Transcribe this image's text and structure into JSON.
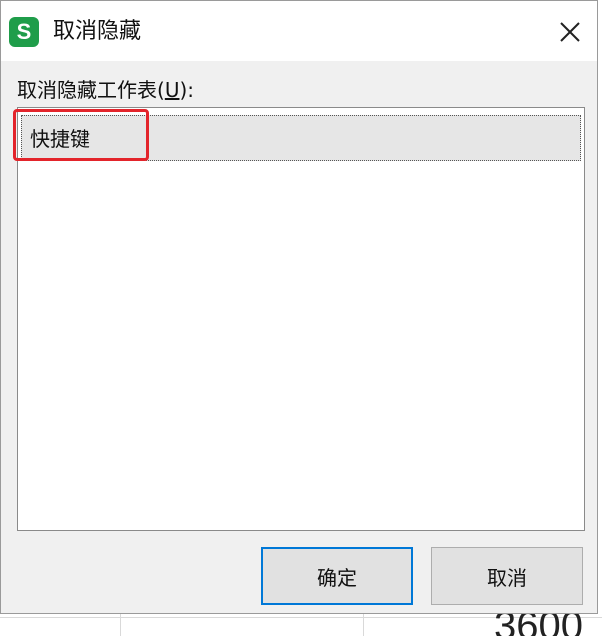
{
  "dialog": {
    "app_icon_letter": "S",
    "title": "取消隐藏",
    "list_label_prefix": "取消隐藏工作表(",
    "list_label_hotkey": "U",
    "list_label_suffix": "):",
    "items": [
      "快捷键"
    ],
    "ok_label": "确定",
    "cancel_label": "取消"
  },
  "background": {
    "cell_text": "3600"
  },
  "colors": {
    "app_icon": "#1f9d4a",
    "highlight": "#e3242b",
    "primary_border": "#0078d7"
  }
}
